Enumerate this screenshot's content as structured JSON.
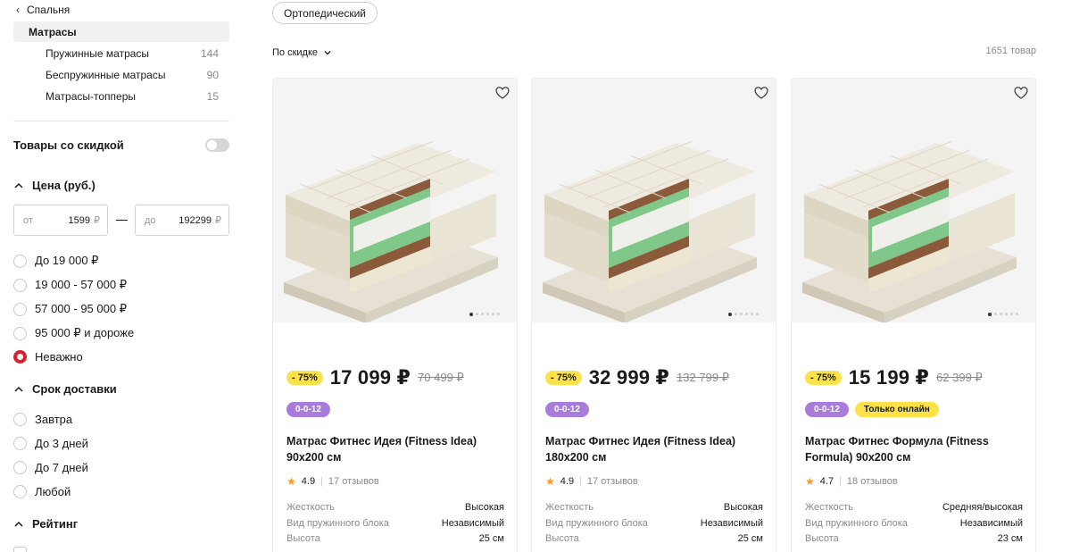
{
  "sidebar": {
    "back_label": "Спальня",
    "active_category": "Матрасы",
    "subcategories": [
      {
        "label": "Пружинные матрасы",
        "count": "144"
      },
      {
        "label": "Беспружинные матрасы",
        "count": "90"
      },
      {
        "label": "Матрасы-топперы",
        "count": "15"
      }
    ],
    "discount_toggle_label": "Товары со скидкой",
    "discount_toggle_on": false,
    "price_section": {
      "title": "Цена (руб.)",
      "from_placeholder": "от",
      "from_value": "1599",
      "to_placeholder": "до",
      "to_value": "192299",
      "currency": "₽",
      "options": [
        "До 19 000 ₽",
        "19 000 - 57 000 ₽",
        "57 000 - 95 000 ₽",
        "95 000 ₽ и дороже",
        "Неважно"
      ],
      "selected_index": 4
    },
    "delivery_section": {
      "title": "Срок доставки",
      "options": [
        "Завтра",
        "До 3 дней",
        "До 7 дней",
        "Любой"
      ]
    },
    "rating_section": {
      "title": "Рейтинг"
    }
  },
  "main": {
    "filter_chip": "Ортопедический",
    "sort_label": "По скидке",
    "total_count": "1651 товар"
  },
  "products": [
    {
      "discount": "- 75%",
      "price": "17 099 ₽",
      "old_price": "70 499 ₽",
      "badges": [
        {
          "text": "0-0-12",
          "style": "purple"
        }
      ],
      "title": "Матрас Фитнес Идея (Fitness Idea) 90x200 см",
      "rating": "4.9",
      "reviews": "17 отзывов",
      "specs": [
        {
          "k": "Жесткость",
          "v": "Высокая"
        },
        {
          "k": "Вид пружинного блока",
          "v": "Независимый"
        },
        {
          "k": "Высота",
          "v": "25 см"
        }
      ]
    },
    {
      "discount": "- 75%",
      "price": "32 999 ₽",
      "old_price": "132 799 ₽",
      "badges": [
        {
          "text": "0-0-12",
          "style": "purple"
        }
      ],
      "title": "Матрас Фитнес Идея (Fitness Idea) 180x200 см",
      "rating": "4.9",
      "reviews": "17 отзывов",
      "specs": [
        {
          "k": "Жесткость",
          "v": "Высокая"
        },
        {
          "k": "Вид пружинного блока",
          "v": "Независимый"
        },
        {
          "k": "Высота",
          "v": "25 см"
        }
      ]
    },
    {
      "discount": "- 75%",
      "price": "15 199 ₽",
      "old_price": "62 399 ₽",
      "badges": [
        {
          "text": "0-0-12",
          "style": "purple"
        },
        {
          "text": "Только онлайн",
          "style": "yellow"
        }
      ],
      "title": "Матрас Фитнес Формула (Fitness Formula) 90x200 см",
      "rating": "4.7",
      "reviews": "18 отзывов",
      "specs": [
        {
          "k": "Жесткость",
          "v": "Средняя/высокая"
        },
        {
          "k": "Вид пружинного блока",
          "v": "Независимый"
        },
        {
          "k": "Высота",
          "v": "23 см"
        }
      ]
    }
  ],
  "colors": {
    "accent_red": "#d9202c",
    "badge_yellow": "#ffe24a",
    "badge_purple": "#a97bdc",
    "star_orange": "#ff9a1f"
  },
  "icons": [
    "chevron-left-icon",
    "chevron-down-icon",
    "chevron-up-icon",
    "heart-icon",
    "star-icon"
  ]
}
